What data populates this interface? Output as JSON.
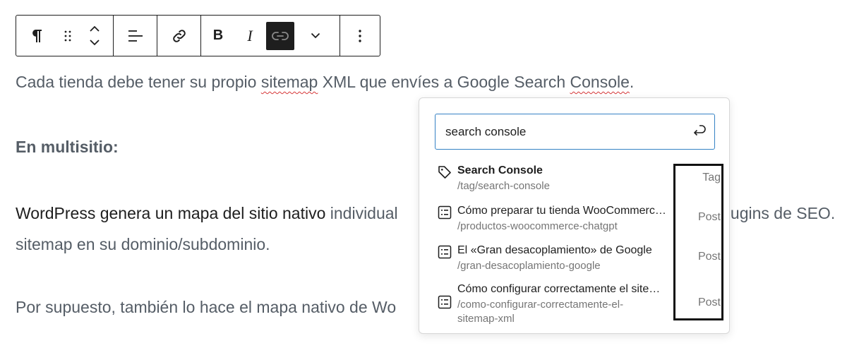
{
  "toolbar": {
    "items": [
      {
        "name": "paragraph",
        "icon": "paragraph-icon"
      },
      {
        "name": "drag",
        "icon": "drag-handle-icon"
      },
      {
        "name": "move",
        "icon": "chevron-up-down-icon"
      },
      {
        "name": "align",
        "icon": "align-left-icon"
      },
      {
        "name": "link",
        "icon": "link-icon"
      },
      {
        "name": "bold",
        "label": "B"
      },
      {
        "name": "italic",
        "label": "I"
      },
      {
        "name": "unlink",
        "icon": "unlink-icon",
        "active": true
      },
      {
        "name": "more-formatting",
        "icon": "chevron-down-icon"
      },
      {
        "name": "options",
        "icon": "more-vertical-icon"
      }
    ],
    "bold_label": "B",
    "italic_label": "I"
  },
  "content": {
    "p1_before": "Cada tienda debe tener su propio ",
    "p1_sitemap": "sitemap",
    "p1_middle": " XML que envíes a Google Search ",
    "p1_console": "Console",
    "p1_after": ".",
    "p2": "En multisitio:",
    "p3_dark": "WordPress genera un mapa del sitio nativo",
    "p3_grey": " individual",
    "p3_right": "plugins de SEO.",
    "p4": "sitemap en su dominio/subdominio.",
    "p5": "Por supuesto, también lo hace el mapa nativo de Wo"
  },
  "link_search": {
    "value": "search console",
    "submit_icon": "enter-icon"
  },
  "results": [
    {
      "title": "Search Console",
      "url": "/tag/search-console",
      "type": "Tag",
      "icon": "tag-icon"
    },
    {
      "title": "Cómo preparar tu tienda WooCommerce para ChatGPT",
      "url": "/productos-woocommerce-chatgpt",
      "type": "Post",
      "icon": "post-list-icon"
    },
    {
      "title": "El «Gran desacoplamiento» de Google",
      "url": "/gran-desacoplamiento-google",
      "type": "Post",
      "icon": "post-list-icon"
    },
    {
      "title": "Cómo configurar correctamente el sitemap XML",
      "url_line1": "/como-configurar-correctamente-el-",
      "url_line2": "sitemap-xml",
      "type": "Post",
      "icon": "post-list-icon"
    }
  ],
  "colors": {
    "accent": "#3582c4",
    "text": "#1e1e1e",
    "muted": "#757575",
    "spellcheck": "#d63638"
  }
}
